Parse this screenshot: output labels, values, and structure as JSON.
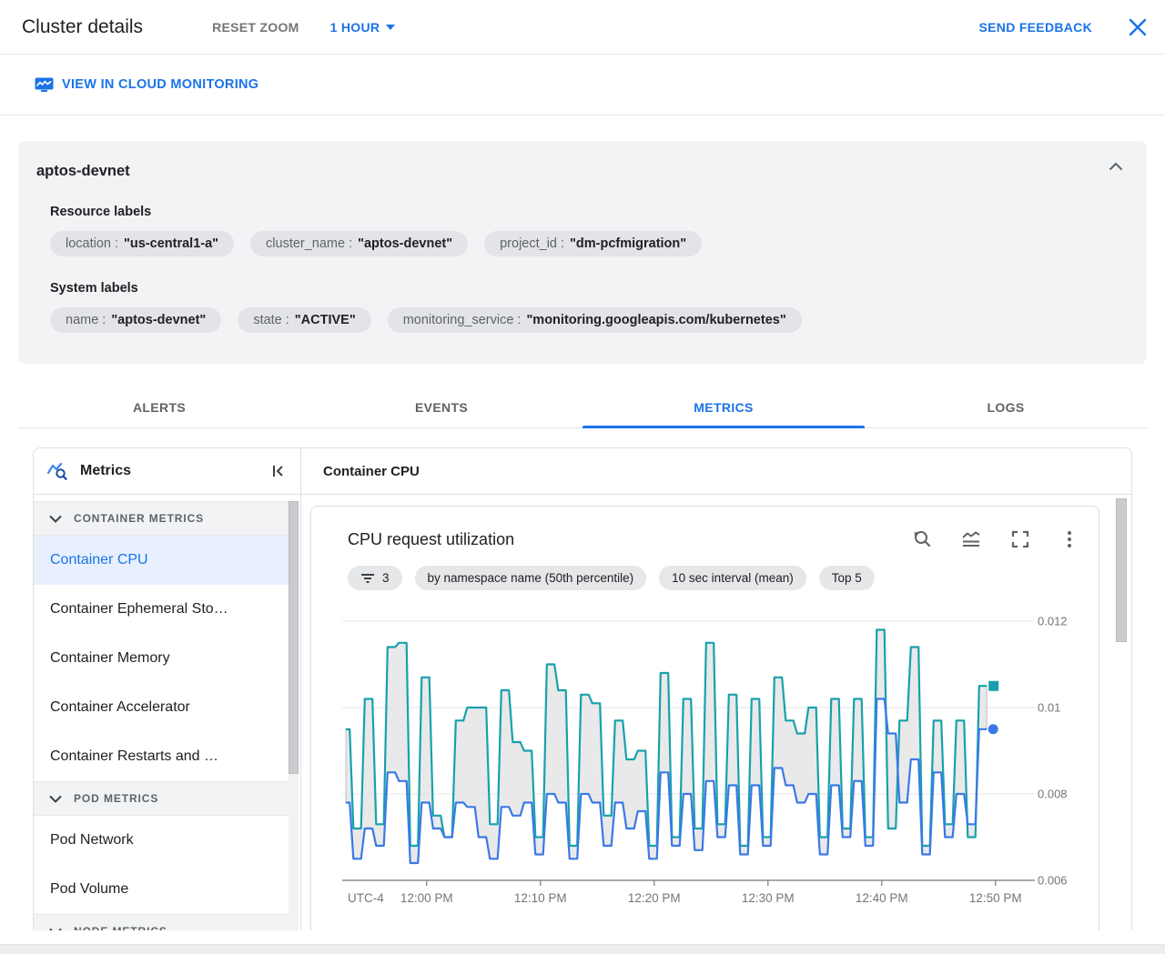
{
  "header": {
    "title": "Cluster details",
    "reset_zoom_label": "RESET ZOOM",
    "time_range_label": "1 HOUR",
    "send_feedback_label": "SEND FEEDBACK"
  },
  "linkbar": {
    "view_in_monitoring_label": "VIEW IN CLOUD MONITORING"
  },
  "cluster_card": {
    "name": "aptos-devnet",
    "resource_labels_title": "Resource labels",
    "resource_labels": [
      {
        "key": "location",
        "value": "\"us-central1-a\""
      },
      {
        "key": "cluster_name",
        "value": "\"aptos-devnet\""
      },
      {
        "key": "project_id",
        "value": "\"dm-pcfmigration\""
      }
    ],
    "system_labels_title": "System labels",
    "system_labels": [
      {
        "key": "name",
        "value": "\"aptos-devnet\""
      },
      {
        "key": "state",
        "value": "\"ACTIVE\""
      },
      {
        "key": "monitoring_service",
        "value": "\"monitoring.googleapis.com/kubernetes\""
      }
    ]
  },
  "tabs": [
    {
      "label": "ALERTS",
      "active": false
    },
    {
      "label": "EVENTS",
      "active": false
    },
    {
      "label": "METRICS",
      "active": true
    },
    {
      "label": "LOGS",
      "active": false
    }
  ],
  "sidebar": {
    "title": "Metrics",
    "sections": [
      {
        "label": "CONTAINER METRICS",
        "items": [
          {
            "label": "Container CPU",
            "selected": true
          },
          {
            "label": "Container Ephemeral Sto…",
            "selected": false
          },
          {
            "label": "Container Memory",
            "selected": false
          },
          {
            "label": "Container Accelerator",
            "selected": false
          },
          {
            "label": "Container Restarts and …",
            "selected": false
          }
        ]
      },
      {
        "label": "POD METRICS",
        "items": [
          {
            "label": "Pod Network",
            "selected": false
          },
          {
            "label": "Pod Volume",
            "selected": false
          }
        ]
      },
      {
        "label": "NODE METRICS",
        "items": []
      }
    ]
  },
  "main": {
    "panel_title": "Container CPU",
    "chart_title": "CPU request utilization",
    "filter_chips": [
      {
        "icon": "filter-icon",
        "label": "3"
      },
      {
        "icon": null,
        "label": "by namespace name (50th percentile)"
      },
      {
        "icon": null,
        "label": "10 sec interval (mean)"
      },
      {
        "icon": null,
        "label": "Top 5"
      }
    ]
  },
  "chart_data": {
    "type": "line",
    "title": "CPU request utilization",
    "x_axis_note": "UTC-4",
    "x_tick_labels": [
      "12:00 PM",
      "12:10 PM",
      "12:20 PM",
      "12:30 PM",
      "12:40 PM",
      "12:50 PM"
    ],
    "x_start_minutes_before_first_tick": 7.1,
    "x_minutes_per_point": 1,
    "ylim": [
      0.006,
      0.012
    ],
    "yticks": [
      0.012,
      0.01,
      0.008,
      0.006
    ],
    "ytick_labels": [
      "0.012",
      "0.01",
      "0.008",
      "0.006"
    ],
    "grid": true,
    "legend": "none",
    "band_fill_between_series": true,
    "colors": {
      "series_high": "#17a1ac",
      "series_low": "#3b78e7",
      "band_fill": "#e1e1e1",
      "band_stroke": "#a9adb1",
      "grid": "#e9e9e9",
      "axis": "#8a8f94",
      "tick_text": "#757575"
    },
    "series": [
      {
        "name": "high (50th percentile, top)",
        "end_marker": "square",
        "values": [
          0.0095,
          0.0072,
          0.0102,
          0.0073,
          0.0114,
          0.0115,
          0.0068,
          0.0107,
          0.0075,
          0.007,
          0.0097,
          0.01,
          0.01,
          0.0073,
          0.0104,
          0.0092,
          0.009,
          0.007,
          0.011,
          0.0104,
          0.0068,
          0.0103,
          0.0101,
          0.0075,
          0.0097,
          0.0088,
          0.009,
          0.0068,
          0.0108,
          0.007,
          0.0102,
          0.0072,
          0.0115,
          0.0073,
          0.0103,
          0.0068,
          0.0102,
          0.007,
          0.0107,
          0.0097,
          0.0094,
          0.01,
          0.007,
          0.0102,
          0.0072,
          0.0102,
          0.007,
          0.0118,
          0.0072,
          0.0097,
          0.0114,
          0.0068,
          0.0097,
          0.0073,
          0.0097,
          0.007,
          0.0105
        ]
      },
      {
        "name": "low (50th percentile, bottom)",
        "end_marker": "circle",
        "values": [
          0.0078,
          0.0065,
          0.0072,
          0.0068,
          0.0085,
          0.0083,
          0.0064,
          0.0078,
          0.0072,
          0.007,
          0.0078,
          0.0077,
          0.007,
          0.0065,
          0.0077,
          0.0075,
          0.0078,
          0.0066,
          0.008,
          0.0078,
          0.0065,
          0.008,
          0.0078,
          0.0068,
          0.0078,
          0.0072,
          0.0076,
          0.0065,
          0.0085,
          0.0068,
          0.008,
          0.0067,
          0.0083,
          0.007,
          0.0082,
          0.0066,
          0.0082,
          0.0068,
          0.0086,
          0.0082,
          0.0078,
          0.008,
          0.0066,
          0.0082,
          0.007,
          0.0083,
          0.0068,
          0.0102,
          0.0094,
          0.0078,
          0.0088,
          0.0066,
          0.0085,
          0.007,
          0.008,
          0.0073,
          0.0095
        ]
      }
    ]
  }
}
